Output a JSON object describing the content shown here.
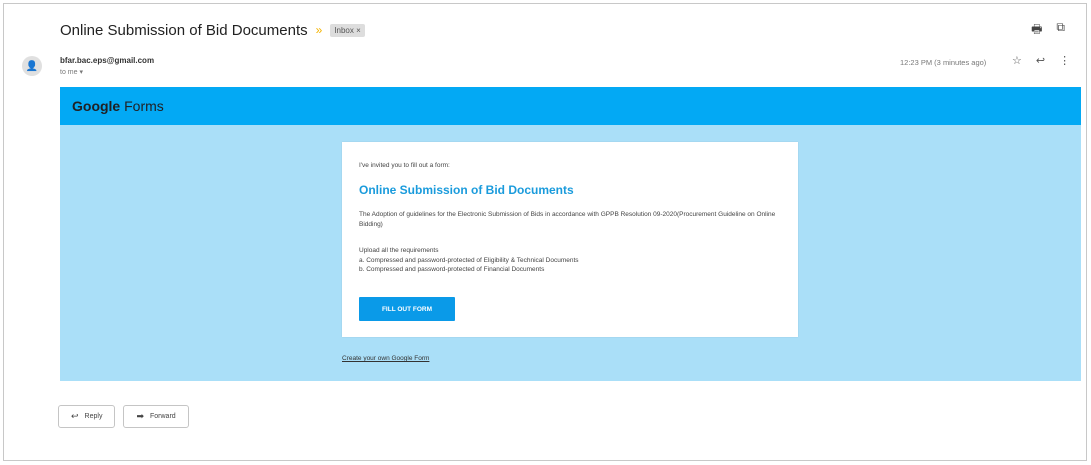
{
  "email": {
    "subject": "Online Submission of Bid Documents",
    "label_chip": "Inbox ×",
    "importance_icon": "importance-marker-icon",
    "top_actions": {
      "print_icon": "print-icon",
      "open_icon": "open-new-window-icon"
    },
    "sender": "bfar.bac.eps@gmail.com",
    "to": "to me ▾",
    "time": "12:23 PM (3 minutes ago)",
    "message_actions": {
      "star": "star-icon",
      "reply": "reply-icon",
      "more": "more-vert-icon"
    }
  },
  "forms": {
    "brand_bold": "Google",
    "brand_rest": " Forms",
    "header_color": "#03a9f4",
    "body_color": "#aadff8",
    "invite_text": "I've invited you to fill out a form:",
    "form_title": "Online Submission of Bid Documents",
    "description": "The Adoption of guidelines for the Electronic Submission of Bids in accordance with GPPB Resolution 09-2020(Procurement Guideline on Online Bidding)",
    "requirements_heading": "Upload all the requirements",
    "requirements": [
      "a. Compressed and password-protected of Eligibility & Technical Documents",
      "b. Compressed and password-protected of Financial Documents"
    ],
    "fill_button": "FILL OUT FORM",
    "create_link": "Create your own Google Form"
  },
  "footer": {
    "reply_label": "Reply",
    "forward_label": "Forward"
  }
}
